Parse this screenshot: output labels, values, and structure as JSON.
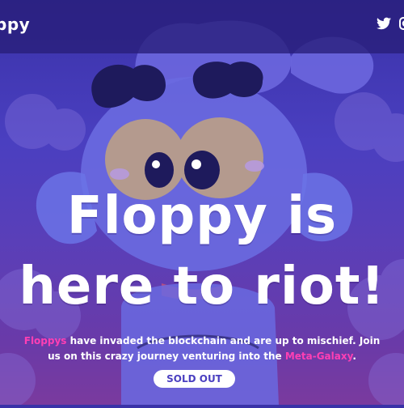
{
  "header": {
    "logo": "ppy",
    "social": [
      "twitter-icon",
      "instagram-icon"
    ]
  },
  "hero": {
    "headline_line1": "Floppy is",
    "headline_line2": "here to riot!",
    "intro_accent1": "Floppys",
    "intro_mid": " have invaded the blockchain and are up to mischief. Join us on this crazy journey venturing into the ",
    "intro_accent2": "Meta-Galaxy",
    "intro_end": ".",
    "cta_label": "SOLD OUT"
  },
  "colors": {
    "accent": "#ff3fb4",
    "background": "#4a3fc0",
    "header_bg": "#2d2478"
  }
}
